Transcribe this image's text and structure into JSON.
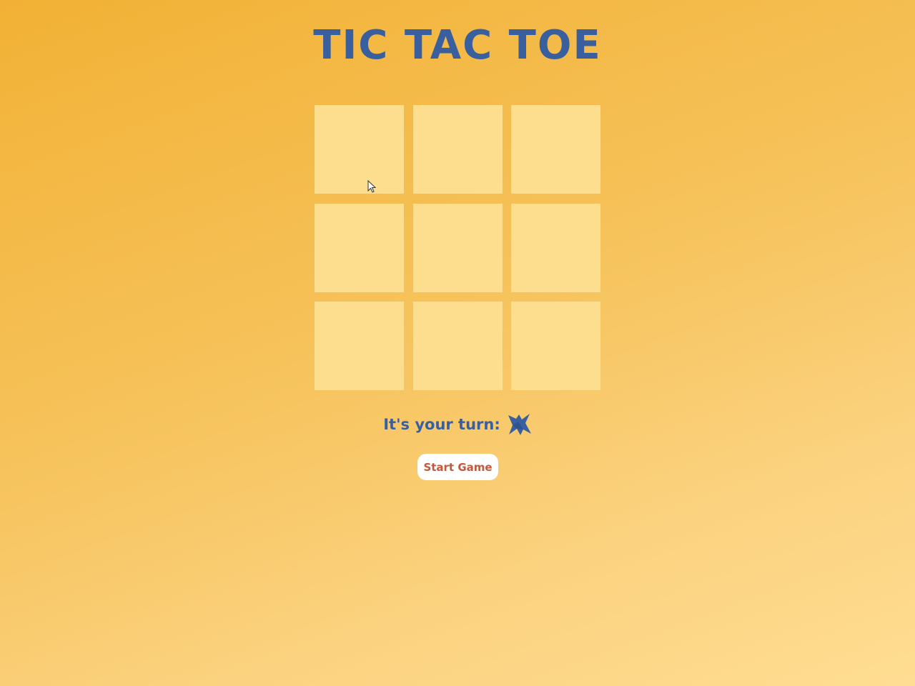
{
  "game": {
    "title": "TIC TAC TOE",
    "board": [
      "",
      "",
      "",
      "",
      "",
      "",
      "",
      "",
      ""
    ],
    "status": {
      "label": "It's your turn:",
      "current_player_icon": "x-brush-icon"
    },
    "start_button_label": "Start Game"
  },
  "colors": {
    "primary_text": "#3a5f9f",
    "cell": "#fddd8e",
    "button_text": "#c8573a",
    "button_bg": "#ffffff",
    "background_start": "#f2b135",
    "background_end": "#ffdd92"
  }
}
